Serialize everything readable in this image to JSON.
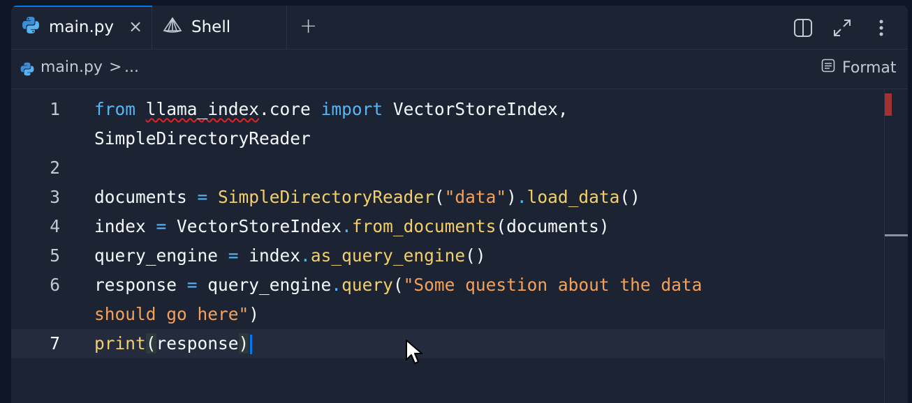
{
  "tabs": [
    {
      "label": "main.py",
      "icon": "python-icon",
      "active": true,
      "close": "×"
    },
    {
      "label": "Shell",
      "icon": "shell-icon",
      "active": false
    }
  ],
  "add_tab": "+",
  "toolbar_icons": [
    "split-pane-icon",
    "maximize-icon",
    "more-vert-icon"
  ],
  "breadcrumb": {
    "file": "main.py",
    "separator": ">",
    "more": "..."
  },
  "format_button": {
    "label": "Format",
    "icon": "format-icon"
  },
  "editor": {
    "lines": [
      {
        "num": "1",
        "text": "from llama_index.core import VectorStoreIndex,",
        "wrap": "SimpleDirectoryReader"
      },
      {
        "num": "2",
        "text": ""
      },
      {
        "num": "3",
        "text": "documents = SimpleDirectoryReader(\"data\").load_data()"
      },
      {
        "num": "4",
        "text": "index = VectorStoreIndex.from_documents(documents)"
      },
      {
        "num": "5",
        "text": "query_engine = index.as_query_engine()"
      },
      {
        "num": "6",
        "text": "response = query_engine.query(\"Some question about the data",
        "wrap": "should go here\")"
      },
      {
        "num": "7",
        "text": "print(response)"
      }
    ],
    "active_line": "7"
  },
  "colors": {
    "background": "#1c2333",
    "keyword": "#56b6f5",
    "function": "#f2cf6b",
    "string": "#f5a15a",
    "accent": "#0079f2",
    "error": "#e52222"
  }
}
